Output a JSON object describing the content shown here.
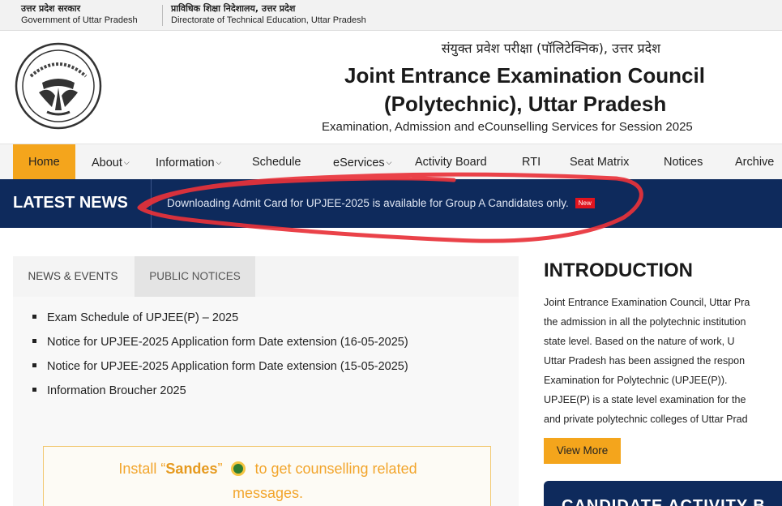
{
  "gov": {
    "left_hindi": "उत्तर प्रदेश सरकार",
    "left_english": "Government of Uttar Pradesh",
    "right_hindi": "प्राविधिक शिक्षा निदेशालय, उत्तर प्रदेश",
    "right_english": "Directorate of Technical Education, Uttar Pradesh"
  },
  "header": {
    "hindi_title": "संयुक्त प्रवेश परीक्षा (पॉलिटेक्निक), उत्तर प्रदेश",
    "title_line1": "Joint Entrance Examination Council",
    "title_line2": "(Polytechnic), Uttar Pradesh",
    "subtitle": "Examination, Admission and eCounselling Services for Session 2025"
  },
  "nav": {
    "items": [
      {
        "label": "Home",
        "active": true
      },
      {
        "label": "About",
        "dropdown": true
      },
      {
        "label": "Information",
        "dropdown": true
      },
      {
        "label": "Schedule"
      },
      {
        "label": "eServices",
        "dropdown": true
      },
      {
        "label": "Activity Board"
      },
      {
        "label": "RTI"
      },
      {
        "label": "Seat Matrix"
      },
      {
        "label": "Notices"
      },
      {
        "label": "Archive"
      }
    ]
  },
  "news": {
    "label": "LATEST NEWS",
    "ticker": "Downloading Admit Card for UPJEE-2025 is available for Group A Candidates only.",
    "badge": "New"
  },
  "panel": {
    "tabs": [
      "NEWS & EVENTS",
      "PUBLIC NOTICES"
    ],
    "items": [
      "Exam Schedule of UPJEE(P) – 2025",
      "Notice for UPJEE-2025 Application form Date extension (16-05-2025)",
      "Notice for UPJEE-2025 Application form Date extension (15-05-2025)",
      "Information Broucher 2025"
    ],
    "sandes": {
      "prefix": "Install “",
      "app": "Sandes",
      "suffix": "” ",
      "rest_line1": " to get counselling related",
      "line2": "messages."
    }
  },
  "intro": {
    "title": "INTRODUCTION",
    "lines": [
      "Joint Entrance Examination Council, Uttar Pra",
      "the admission in all the polytechnic institution",
      "state level. Based on the nature of work, U",
      "Uttar Pradesh has been assigned the respon",
      "Examination for Polytechnic (UPJEE(P)).",
      "UPJEE(P) is a state level examination for the",
      "and private polytechnic colleges of Uttar Prad"
    ],
    "button": "View More",
    "activity_title": "CANDIDATE ACTIVITY B"
  },
  "colors": {
    "accent": "#f4a51c",
    "navy": "#0e2a5c",
    "badge_red": "#e1141e",
    "scribble": "#e8323a"
  }
}
